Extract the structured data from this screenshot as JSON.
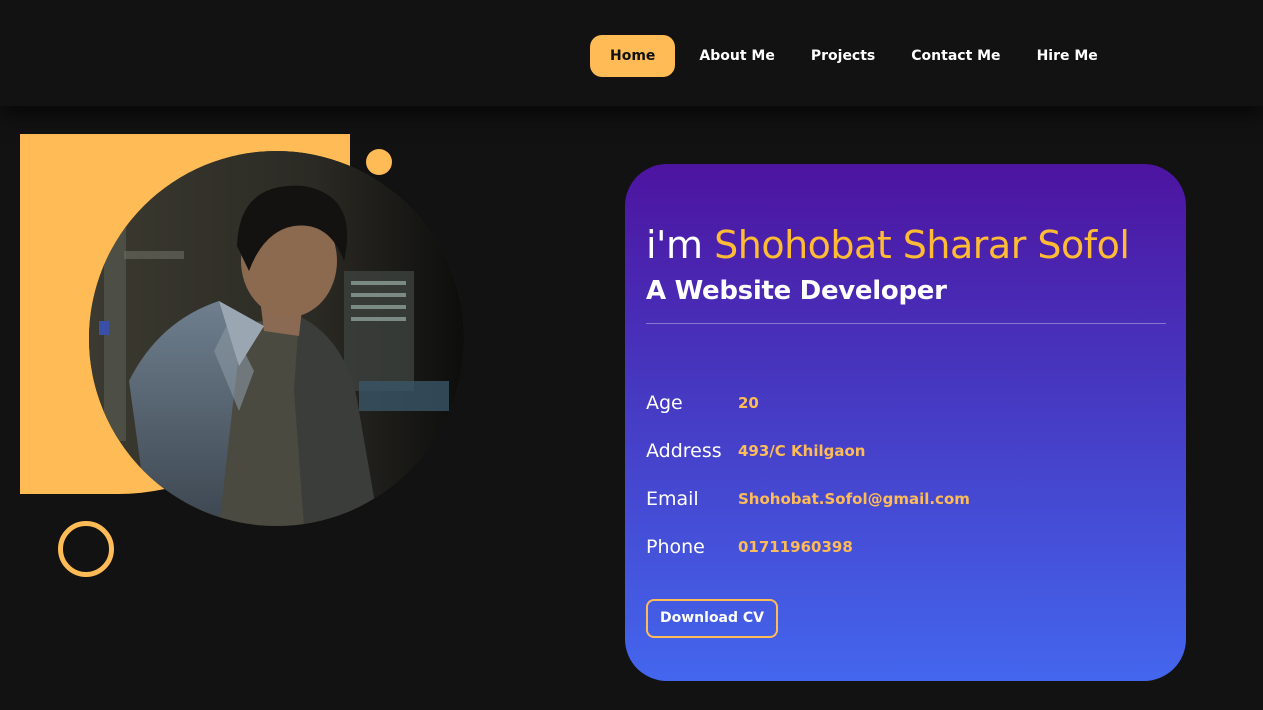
{
  "nav": {
    "items": [
      {
        "label": "Home",
        "active": true
      },
      {
        "label": "About Me",
        "active": false
      },
      {
        "label": "Projects",
        "active": false
      },
      {
        "label": "Contact Me",
        "active": false
      },
      {
        "label": "Hire Me",
        "active": false
      }
    ]
  },
  "hero": {
    "greeting_prefix": "i'm",
    "name": "Shohobat Sharar Sofol",
    "role": "A Website Developer",
    "info": [
      {
        "label": "Age",
        "value": "20"
      },
      {
        "label": "Address",
        "value": "493/C Khilgaon"
      },
      {
        "label": "Email",
        "value": "Shohobat.Sofol@gmail.com"
      },
      {
        "label": "Phone",
        "value": "01711960398"
      }
    ],
    "cv_button": "Download CV"
  },
  "colors": {
    "accent": "#ffbb55",
    "background": "#121212",
    "card_gradient_top": "#4d14a0",
    "card_gradient_bottom": "#4466ee"
  }
}
